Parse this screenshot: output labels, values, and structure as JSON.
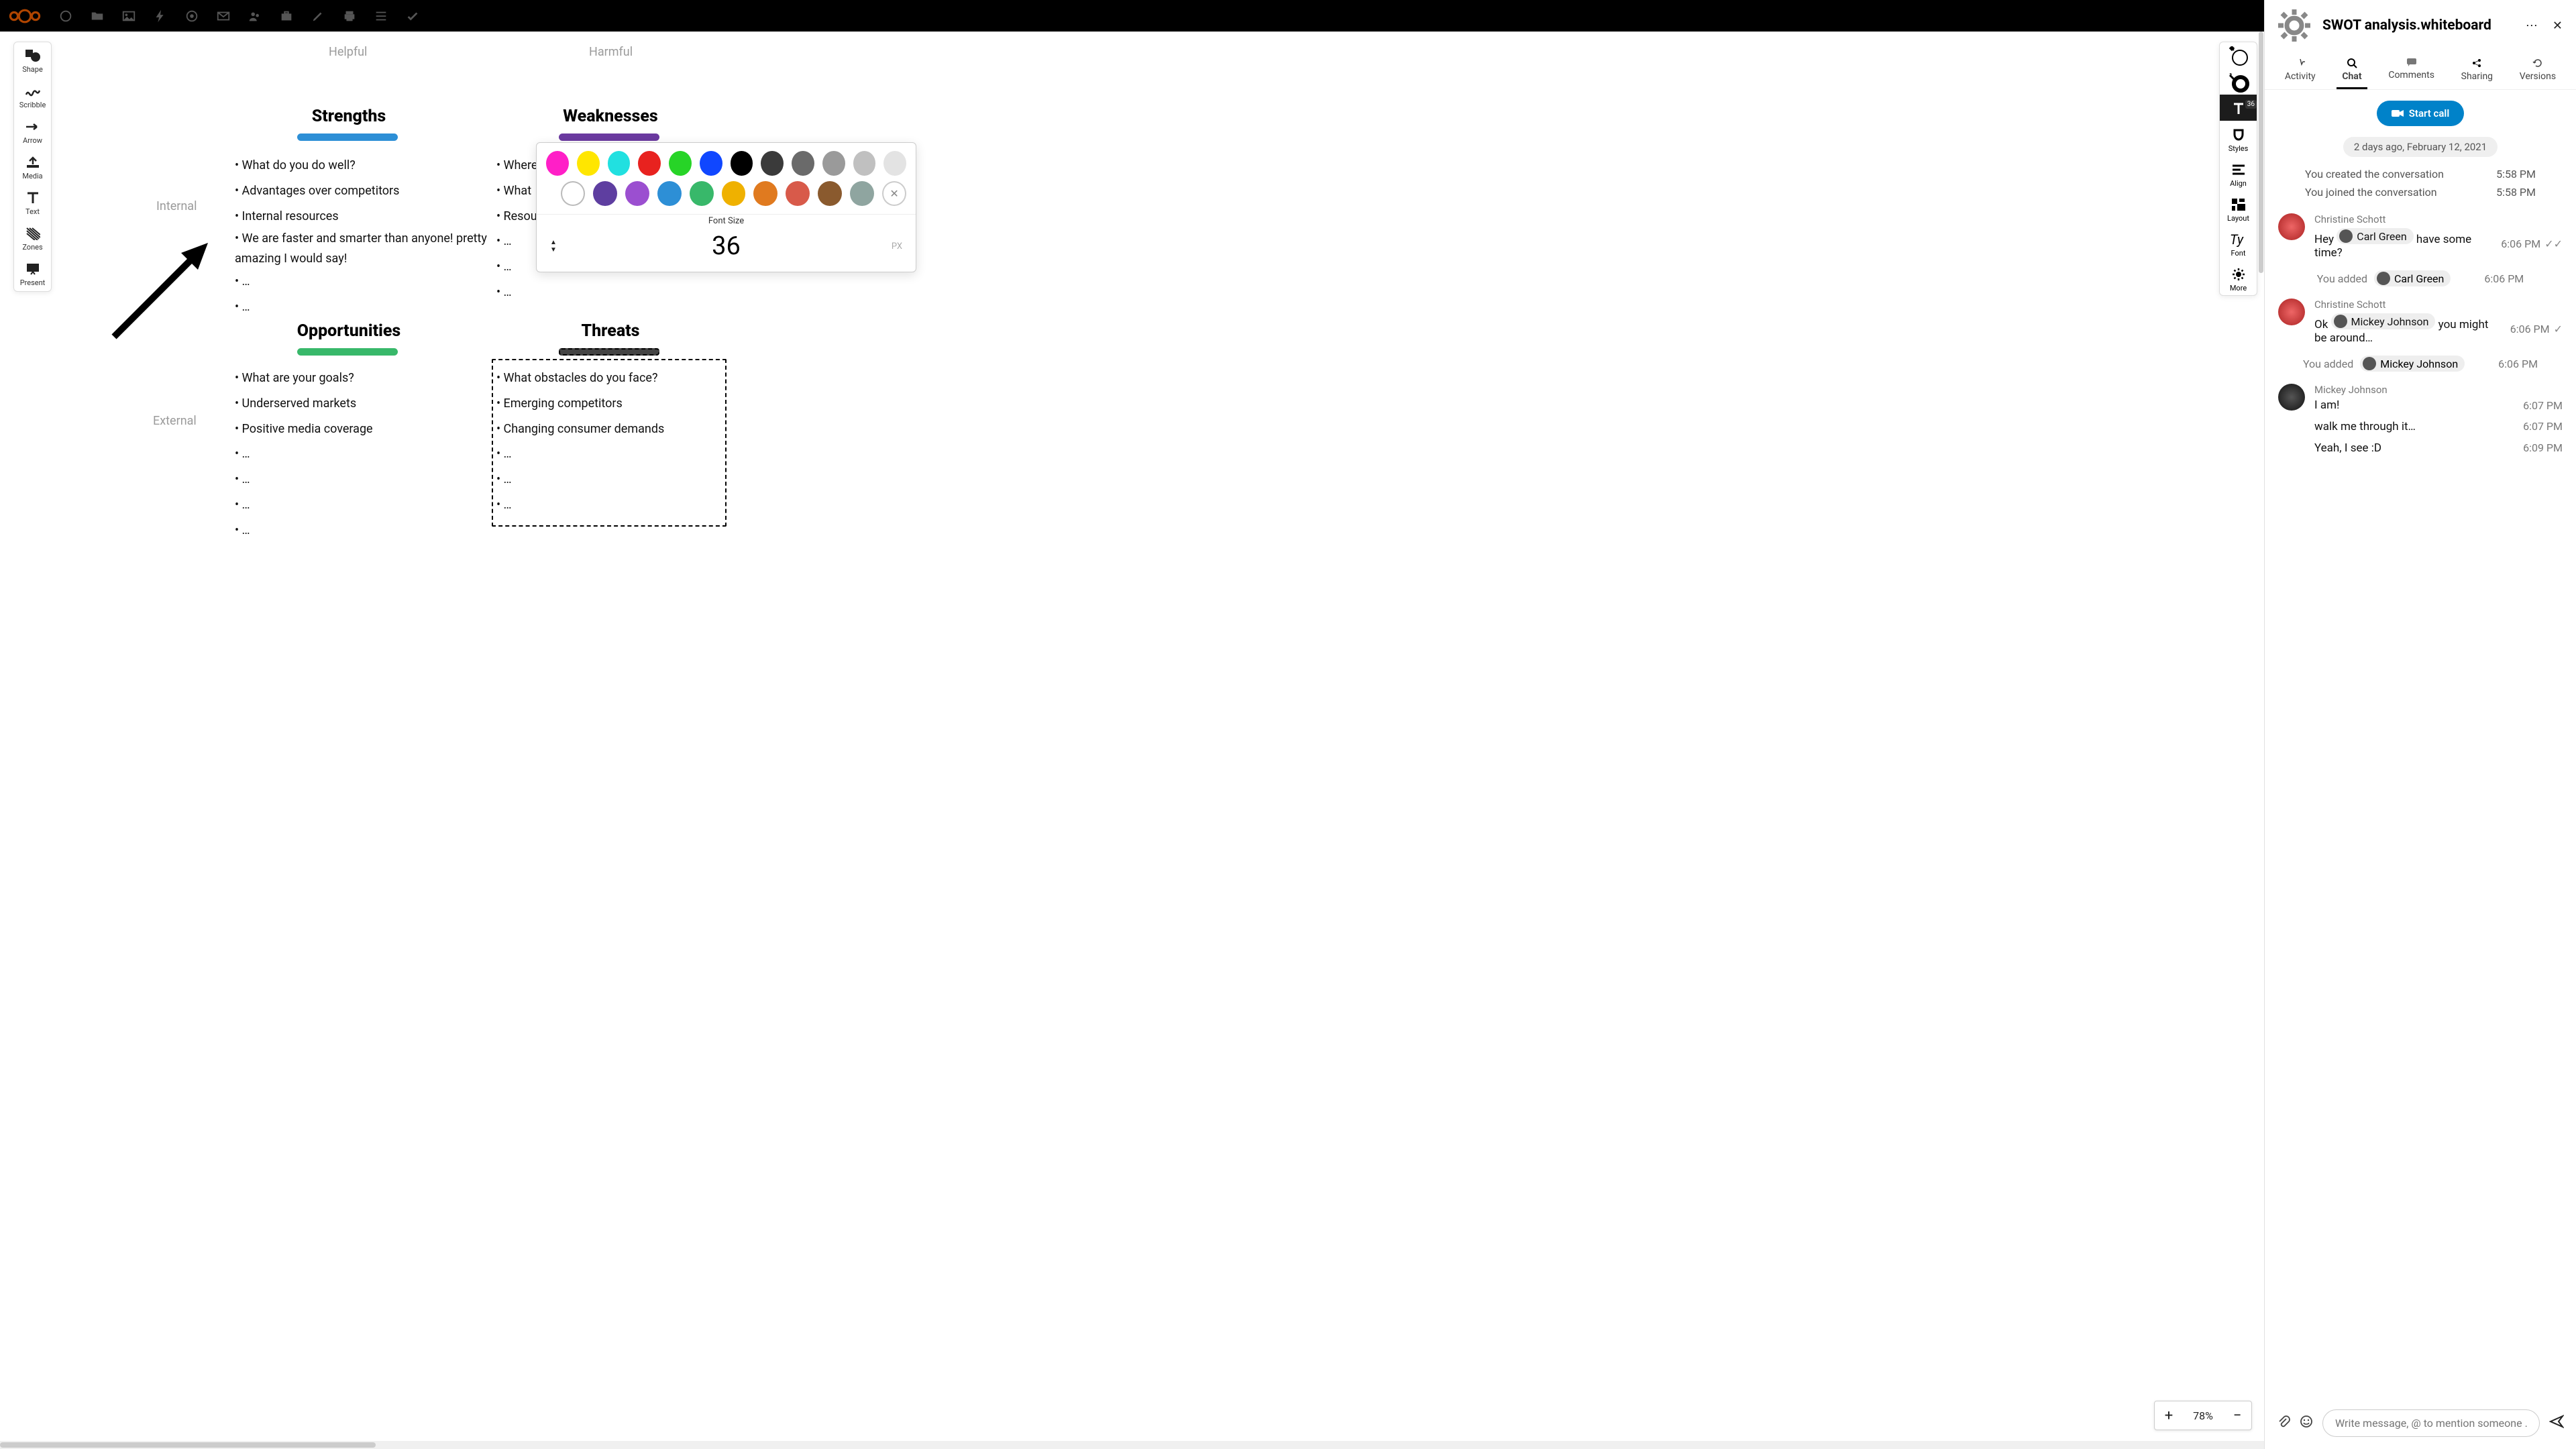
{
  "topbar": {
    "icons": [
      "circle",
      "folder",
      "picture",
      "lightning",
      "target",
      "mail",
      "people",
      "briefcase",
      "pencil",
      "printer",
      "list",
      "check"
    ]
  },
  "left_tools": [
    {
      "id": "shape",
      "label": "Shape"
    },
    {
      "id": "scribble",
      "label": "Scribble"
    },
    {
      "id": "arrow",
      "label": "Arrow"
    },
    {
      "id": "media",
      "label": "Media"
    },
    {
      "id": "text",
      "label": "Text"
    },
    {
      "id": "zones",
      "label": "Zones"
    },
    {
      "id": "present",
      "label": "Present"
    }
  ],
  "right_tools": [
    {
      "id": "fill",
      "label": ""
    },
    {
      "id": "stroke",
      "label": ""
    },
    {
      "id": "textstyle",
      "label": "",
      "selected": true,
      "badge": "36"
    },
    {
      "id": "styles",
      "label": "Styles"
    },
    {
      "id": "align",
      "label": "Align"
    },
    {
      "id": "layout",
      "label": "Layout"
    },
    {
      "id": "font",
      "label": "Font"
    },
    {
      "id": "more",
      "label": "More"
    }
  ],
  "zoom": "78%",
  "axes": {
    "helpful": "Helpful",
    "harmful": "Harmful",
    "internal": "Internal",
    "external": "External"
  },
  "quads": {
    "strengths": {
      "title": "Strengths",
      "items": [
        "• What do you do well?",
        "• Advantages over competitors",
        "• Internal resources",
        "• We are faster and smarter than anyone! pretty amazing I would say!",
        "• …",
        "• …"
      ]
    },
    "weaknesses": {
      "title": "Weaknesses",
      "items": [
        "• Where",
        "• What",
        "• Resou",
        "• …",
        "• …",
        "• …"
      ]
    },
    "opportunities": {
      "title": "Opportunities",
      "items": [
        "• What are your goals?",
        "• Underserved markets",
        "• Positive media coverage",
        "• …",
        "• …",
        "• …",
        "• …"
      ]
    },
    "threats": {
      "title": "Threats",
      "items": [
        "• What obstacles do you face?",
        "• Emerging competitors",
        "• Changing consumer demands",
        "• …",
        "• …",
        "• …"
      ]
    }
  },
  "popover": {
    "row1_colors": [
      "#ff1fc7",
      "#ffe600",
      "#21e0e0",
      "#e8221f",
      "#27d427",
      "#1047ff",
      "#000000",
      "#3a3a3a",
      "#6a6a6a",
      "#9a9a9a",
      "#c0c0c0",
      "#e3e3e3"
    ],
    "row2_colors": [
      "#ffffff",
      "#5e3ea0",
      "#9b4fd0",
      "#2d8fd6",
      "#38b86a",
      "#efb100",
      "#e07a1f",
      "#d85a4a",
      "#8a5a2e",
      "#8fa5a0"
    ],
    "font_size_label": "Font Size",
    "font_size_value": "36",
    "font_size_unit": "PX"
  },
  "chat": {
    "title": "SWOT analysis.whiteboard",
    "tabs": [
      {
        "id": "activity",
        "label": "Activity"
      },
      {
        "id": "chat",
        "label": "Chat",
        "active": true
      },
      {
        "id": "comments",
        "label": "Comments"
      },
      {
        "id": "sharing",
        "label": "Sharing"
      },
      {
        "id": "versions",
        "label": "Versions"
      }
    ],
    "call_label": "Start call",
    "date_chip": "2 days ago, February 12, 2021",
    "system": [
      {
        "text": "You created the conversation",
        "time": "5:58 PM"
      },
      {
        "text": "You joined the conversation",
        "time": "5:58 PM"
      }
    ],
    "messages": [
      {
        "avatar": "cs",
        "name": "Christine Schott",
        "text_pre": "Hey ",
        "mention": "Carl Green",
        "text_post": "  have some time?",
        "time": "6:06 PM",
        "checks": 2
      },
      {
        "added": "You added",
        "mention": "Carl Green",
        "time": "6:06 PM"
      },
      {
        "avatar": "cs",
        "name": "Christine Schott",
        "text_pre": "Ok ",
        "mention": "Mickey Johnson",
        "text_post": "  you might be around…",
        "time": "6:06 PM",
        "checks": 1
      },
      {
        "added": "You added",
        "mention": "Mickey Johnson",
        "time": "6:06 PM"
      },
      {
        "avatar": "mj",
        "name": "Mickey Johnson",
        "text": "I am!",
        "time": "6:07 PM"
      },
      {
        "cont": true,
        "text": "walk me through it…",
        "time": "6:07 PM"
      },
      {
        "cont": true,
        "text": "Yeah, I see :D",
        "time": "6:09 PM"
      }
    ],
    "input_placeholder": "Write message, @ to mention someone …"
  }
}
